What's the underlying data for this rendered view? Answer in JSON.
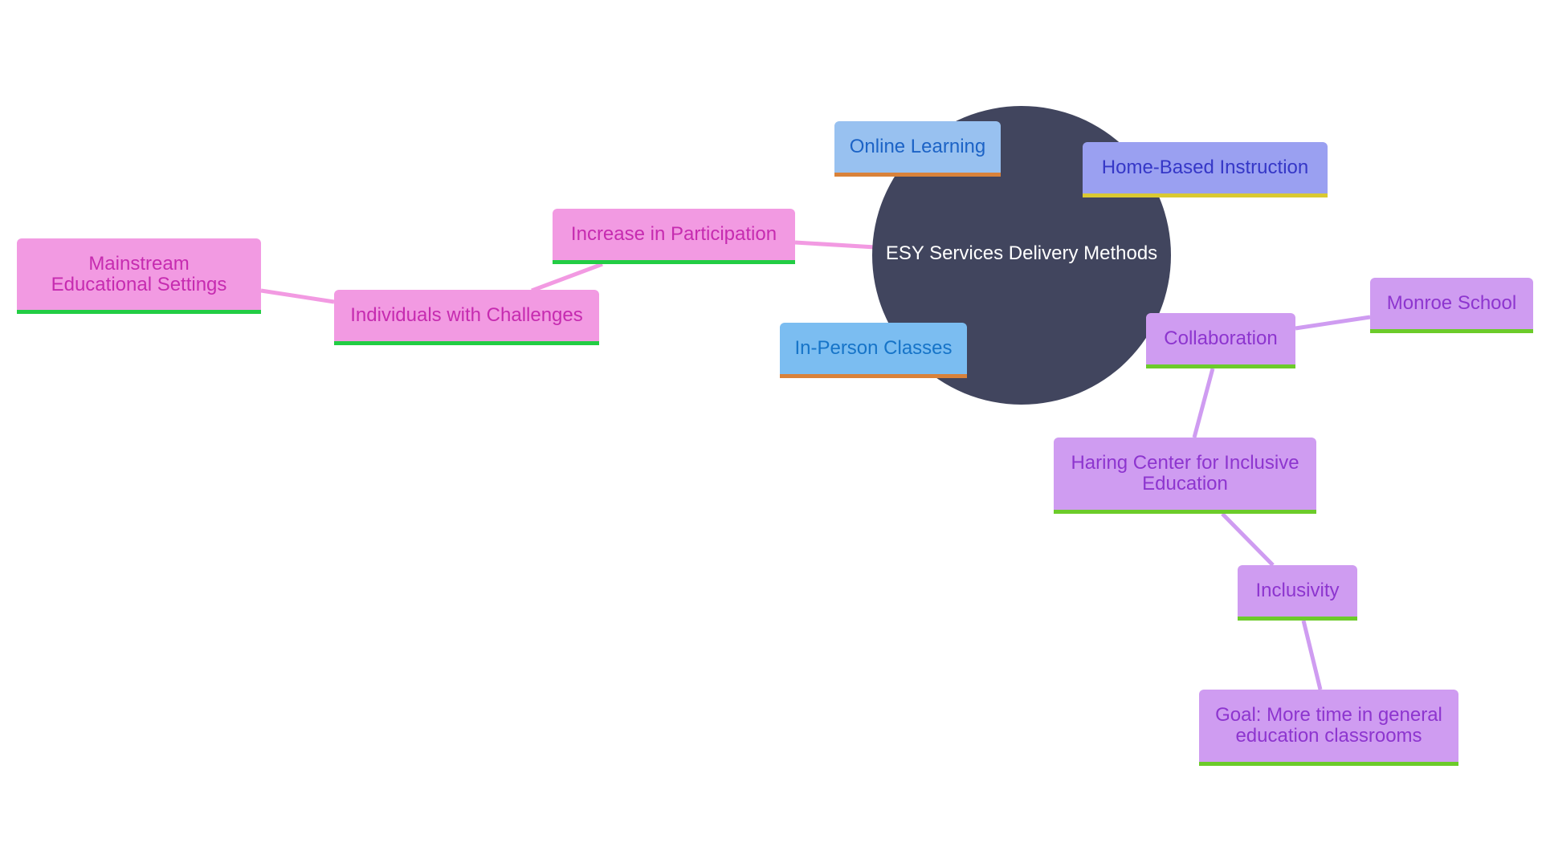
{
  "diagram": {
    "type": "mindmap",
    "root": {
      "label": "ESY Services Delivery Methods",
      "color": "#41455e"
    },
    "nodes": [
      {
        "id": "online",
        "label": "Online Learning",
        "parent": "root",
        "fill": "#98c1f0",
        "accent": "#d9823a"
      },
      {
        "id": "home",
        "label": "Home-Based Instruction",
        "parent": "root",
        "fill": "#9aa0f1",
        "accent": "#d9c932"
      },
      {
        "id": "inperson",
        "label": "In-Person Classes",
        "parent": "root",
        "fill": "#7bbdf1",
        "accent": "#d9823a"
      },
      {
        "id": "increase",
        "label": "Increase in Participation",
        "parent": "root",
        "fill": "#f29ae2",
        "accent": "#22cd44"
      },
      {
        "id": "individuals",
        "label": "Individuals with Challenges",
        "parent": "increase",
        "fill": "#f29ae2",
        "accent": "#22cd44"
      },
      {
        "id": "mainstream",
        "label": "Mainstream Educational Settings",
        "parent": "individuals",
        "fill": "#f29ae2",
        "accent": "#22cd44"
      },
      {
        "id": "collab",
        "label": "Collaboration",
        "parent": "root",
        "fill": "#cf9cf1",
        "accent": "#6ccb2a"
      },
      {
        "id": "monroe",
        "label": "Monroe School",
        "parent": "collab",
        "fill": "#cf9cf1",
        "accent": "#6ccb2a"
      },
      {
        "id": "haring",
        "label": "Haring Center for Inclusive Education",
        "parent": "collab",
        "fill": "#cf9cf1",
        "accent": "#6ccb2a"
      },
      {
        "id": "inclusivity",
        "label": "Inclusivity",
        "parent": "haring",
        "fill": "#cf9cf1",
        "accent": "#6ccb2a"
      },
      {
        "id": "goal",
        "label": "Goal: More time in general education classrooms",
        "parent": "inclusivity",
        "fill": "#cf9cf1",
        "accent": "#6ccb2a"
      }
    ],
    "edge_colors": {
      "pink": "#f29ae2",
      "purple": "#cf9cf1"
    }
  }
}
